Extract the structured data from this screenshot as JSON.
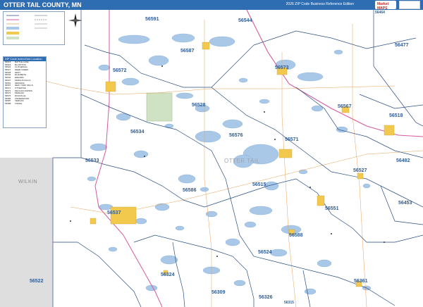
{
  "header": {
    "title": "OTTER TAIL COUNTY, MN",
    "edition": "2026 ZIP Code Business Reference Edition"
  },
  "logo": {
    "text": "Market MAPS"
  },
  "legend": {
    "rows": [
      "",
      "",
      "",
      "",
      "",
      ""
    ]
  },
  "zip_index": {
    "title": "ZIP Code Index/Grid Location",
    "rows": [
      {
        "zip": "56515",
        "city": "BATTLE LAKE"
      },
      {
        "zip": "56518",
        "city": "BLUFFTON"
      },
      {
        "zip": "56524",
        "city": "CLITHERALL"
      },
      {
        "zip": "56527",
        "city": "DEER CREEK"
      },
      {
        "zip": "56528",
        "city": "DENT"
      },
      {
        "zip": "56533",
        "city": "ELIZABETH"
      },
      {
        "zip": "56534",
        "city": "ERHARD"
      },
      {
        "zip": "56537",
        "city": "FERGUS FALLS"
      },
      {
        "zip": "56551",
        "city": "HENNING"
      },
      {
        "zip": "56567",
        "city": "NEW YORK MILLS"
      },
      {
        "zip": "56571",
        "city": "OTTERTAIL"
      },
      {
        "zip": "56572",
        "city": "PELICAN RAPIDS"
      },
      {
        "zip": "56573",
        "city": "PERHAM"
      },
      {
        "zip": "56576",
        "city": "RICHVILLE"
      },
      {
        "zip": "56586",
        "city": "UNDERWOOD"
      },
      {
        "zip": "56587",
        "city": "VERGAS"
      },
      {
        "zip": "56588",
        "city": "VINING"
      }
    ]
  },
  "counties": {
    "center": "OTTER TAIL",
    "west": "WILKIN"
  },
  "zip_labels": [
    "56591",
    "56544",
    "56587",
    "56477",
    "56573",
    "56572",
    "56528",
    "56567",
    "56518",
    "56534",
    "56576",
    "56571",
    "56533",
    "56527",
    "56482",
    "56515",
    "56586",
    "56551",
    "56453",
    "56537",
    "56588",
    "56524",
    "56324",
    "56522",
    "56309",
    "56326",
    "56361",
    "56315",
    "56464"
  ],
  "colors": {
    "title_bar": "#2f6db3",
    "water": "#a9c8e8",
    "zip_boundary": "#2a4f85",
    "highway": "#d45aa0",
    "road": "#e8a05a",
    "town": "#f2c94c"
  }
}
